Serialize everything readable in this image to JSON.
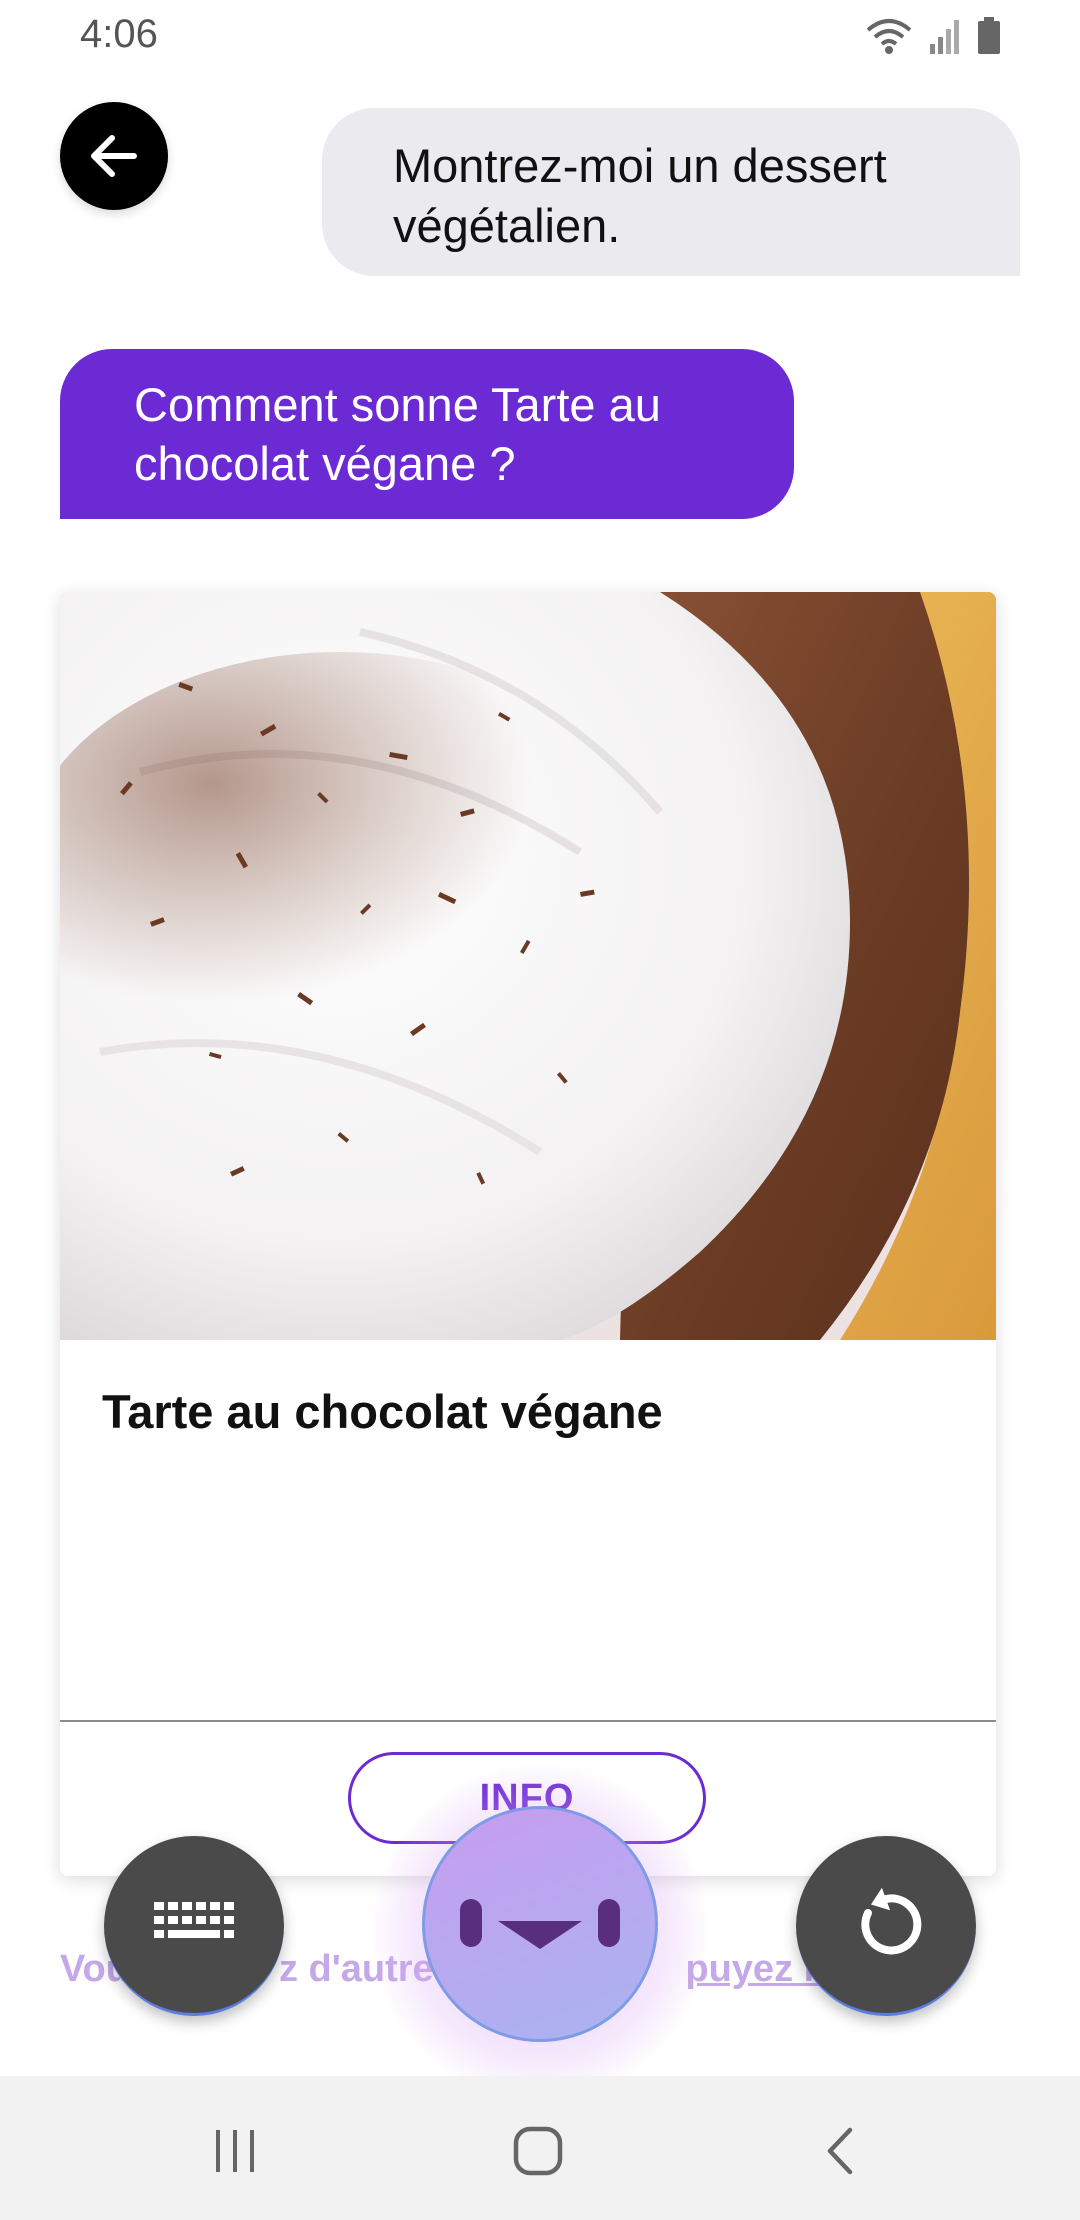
{
  "status_bar": {
    "time": "4:06",
    "icons": [
      "wifi-icon",
      "signal-icon",
      "battery-icon"
    ]
  },
  "back_button": {
    "icon": "arrow-left-icon"
  },
  "conversation": {
    "user_message": "Montrez-moi un dessert végétalien.",
    "assistant_message": "Comment sonne Tarte au chocolat végane ?"
  },
  "recipe_card": {
    "title": "Tarte au chocolat végane",
    "info_button": "INFO"
  },
  "help": {
    "prefix": "Vou",
    "middle": "z d'autres ",
    "link": "puyez ici."
  },
  "bottom_controls": {
    "keyboard_icon": "keyboard-icon",
    "assistant_icon": "assistant-face-icon",
    "reload_icon": "reload-icon"
  },
  "navigation_bar": {
    "icons": [
      "recent-apps-icon",
      "home-icon",
      "back-icon"
    ]
  },
  "colors": {
    "accent": "#6c2ad4",
    "user_bubble": "#ebebef",
    "control_dark": "#4a4a4a"
  }
}
